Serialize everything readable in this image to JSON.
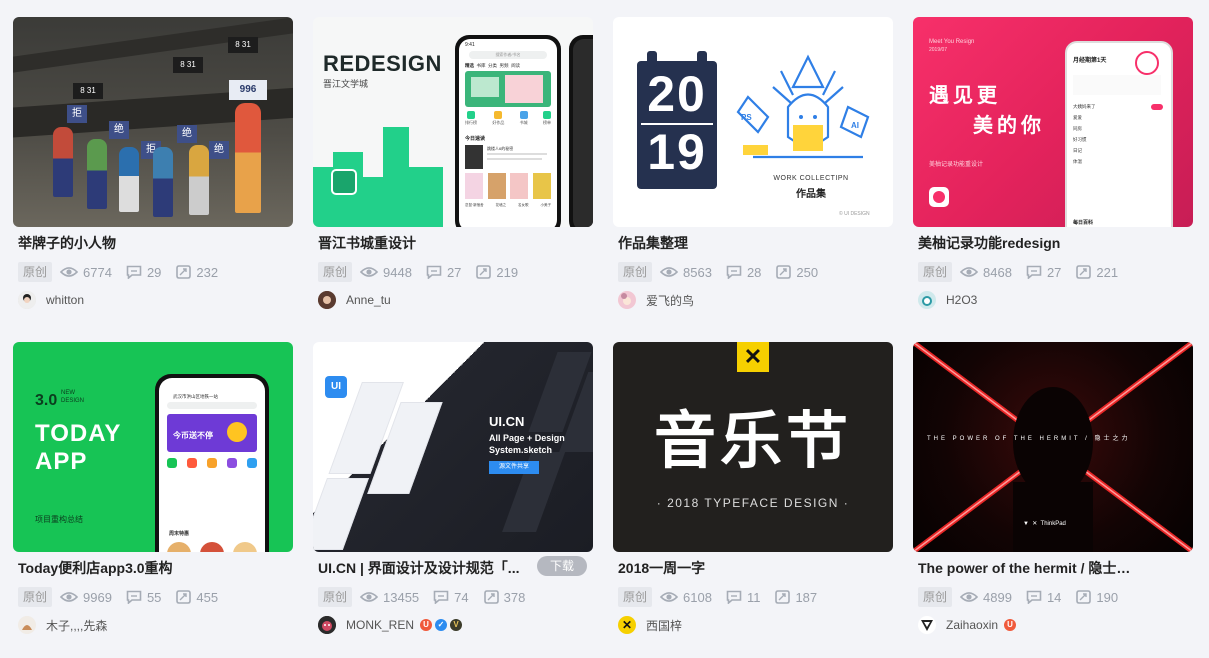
{
  "cards": [
    {
      "title": "举牌子的小人物",
      "tag": "原创",
      "views": "6774",
      "comments": "29",
      "likes": "232",
      "author": "whitton",
      "thumb": {
        "signs": [
          "8 31",
          "8 31",
          "996",
          "拒",
          "绝",
          "拒",
          "绝",
          "绝",
          "8 31"
        ]
      }
    },
    {
      "title": "晋江书城重设计",
      "tag": "原创",
      "views": "9448",
      "comments": "27",
      "likes": "219",
      "author": "Anne_tu",
      "thumb": {
        "heading": "REDESIGN",
        "sub": "晋江文学城",
        "phone_time": "9:41",
        "phone_search": "搜索作者/书名",
        "phone_section": "今日速读",
        "phone_tabs": [
          "精选",
          "书库",
          "分类",
          "男频",
          "阅读"
        ],
        "phone_icons": [
          "排行榜",
          "好作品",
          "书城",
          "榜单"
        ],
        "phone_text": "跳楼人6的秘密",
        "phone_foot": [
          "恋鼠·新宿舍",
          "花墙之",
          "名女歌",
          "小美子"
        ]
      }
    },
    {
      "title": "作品集整理",
      "tag": "原创",
      "views": "8563",
      "comments": "28",
      "likes": "250",
      "author": "爱飞的鸟",
      "thumb": {
        "year_top": "20",
        "year_bottom": "19",
        "caption_en": "WORK COLLECTIPN",
        "caption_cn": "作品集",
        "badge_ps": "PS",
        "badge_ai": "AI",
        "corner_text": "© UI DESIGN"
      }
    },
    {
      "title": "美柚记录功能redesign",
      "tag": "原创",
      "views": "8468",
      "comments": "27",
      "likes": "221",
      "author": "H2O3",
      "thumb": {
        "top_text": "Meet You Resign",
        "top_sub": "2019/07",
        "line1": "遇见更",
        "line2": "美的你",
        "desc": "美柚记录功能重设计",
        "phone_header": "月经期第1天",
        "items": [
          "大姨妈来了",
          "爱爱",
          "同房",
          "好习惯",
          "日记",
          "体温"
        ],
        "phone_foot": "每日百科"
      }
    },
    {
      "title": "Today便利店app3.0重构",
      "tag": "原创",
      "views": "9969",
      "comments": "55",
      "likes": "455",
      "author": "木子,,,,先森",
      "thumb": {
        "version": "3.0",
        "version_sub": "NEW DESIGN",
        "line1": "TODAY",
        "line2": "APP",
        "foot": "项目重构总结",
        "phone_addr": "武汉市洪山区地铁一站",
        "banner": "今币送不停",
        "phone_section": "周末特惠"
      }
    },
    {
      "title": "UI.CN | 界面设计及设计规范「...",
      "tag": "原创",
      "views": "13455",
      "comments": "74",
      "likes": "378",
      "author": "MONK_REN",
      "badge": "下载",
      "thumb": {
        "heading": "UI.CN",
        "line1": "All Page + Design",
        "line2": "System.sketch",
        "button": "源文件共享",
        "logo": "UI"
      }
    },
    {
      "title": "2018一周一字",
      "tag": "原创",
      "views": "6108",
      "comments": "11",
      "likes": "187",
      "author": "西国梓",
      "thumb": {
        "big": "音乐节",
        "sub": "2018 TYPEFACE DESIGN"
      }
    },
    {
      "title": "The power of the hermit / 隐士之力",
      "tag": "原创",
      "views": "4899",
      "comments": "14",
      "likes": "190",
      "author": "Zaihaoxin",
      "thumb": {
        "tagline": "THE POWER OF THE HERMIT / 隐士之力",
        "brand": "ThinkPad"
      }
    }
  ]
}
